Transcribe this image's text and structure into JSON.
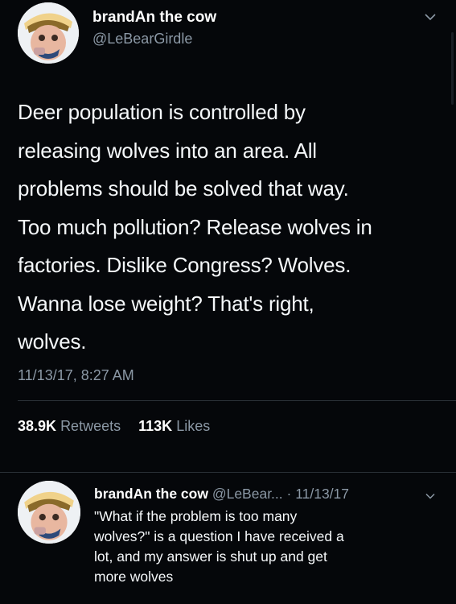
{
  "tweet": {
    "author_name": "brandAn the cow",
    "author_handle": "@LeBearGirdle",
    "text_lines": [
      "Deer population is controlled by",
      "releasing wolves into an area. All",
      "problems should be solved that way.",
      "Too much pollution? Release wolves in",
      "factories. Dislike Congress? Wolves.",
      "Wanna lose weight? That's right,",
      "wolves."
    ],
    "timestamp": "11/13/17, 8:27 AM",
    "retweets_count": "38.9K",
    "retweets_label": "Retweets",
    "likes_count": "113K",
    "likes_label": "Likes",
    "menu_icon": "chevron-down-icon"
  },
  "reply": {
    "author_name": "brandAn the cow",
    "meta": "@LeBear... · 11/13/17",
    "text_lines": [
      "\"What if the problem is too many",
      "wolves?\" is a question I have received a",
      "lot, and my answer is shut up and get",
      "more wolves"
    ],
    "menu_icon": "chevron-down-icon"
  },
  "colors": {
    "background": "#05070a",
    "primary_text": "#f5f8fa",
    "secondary_text": "#8b98a5",
    "divider": "#2b3138"
  }
}
